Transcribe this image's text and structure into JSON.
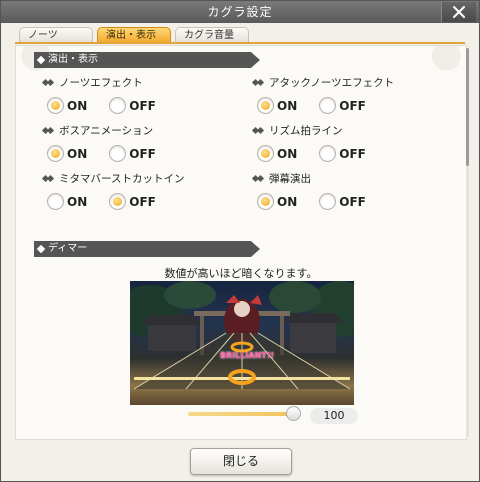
{
  "window": {
    "title": "カグラ設定"
  },
  "tabs": [
    {
      "label": "ノーツ"
    },
    {
      "label": "演出・表示"
    },
    {
      "label": "カグラ音量"
    }
  ],
  "sections": {
    "effects": {
      "title": "演出・表示"
    },
    "dimmer": {
      "title": "ディマー",
      "description": "数値が高いほど暗くなります。"
    }
  },
  "settings": [
    {
      "label": "ノーツエフェクト",
      "on": "ON",
      "off": "OFF",
      "selected": "ON"
    },
    {
      "label": "アタックノーツエフェクト",
      "on": "ON",
      "off": "OFF",
      "selected": "ON"
    },
    {
      "label": "ボスアニメーション",
      "on": "ON",
      "off": "OFF",
      "selected": "ON"
    },
    {
      "label": "リズム拍ライン",
      "on": "ON",
      "off": "OFF",
      "selected": "ON"
    },
    {
      "label": "ミタマバーストカットイン",
      "on": "ON",
      "off": "OFF",
      "selected": "OFF"
    },
    {
      "label": "弾幕演出",
      "on": "ON",
      "off": "OFF",
      "selected": "ON"
    }
  ],
  "preview": {
    "judgement_text": "BRILLIANT!!"
  },
  "dimmer_slider": {
    "value": "100",
    "level": 1.0
  },
  "footer": {
    "close_label": "閉じる"
  },
  "colors": {
    "accent": "#f2a72c",
    "header": "#555555"
  }
}
